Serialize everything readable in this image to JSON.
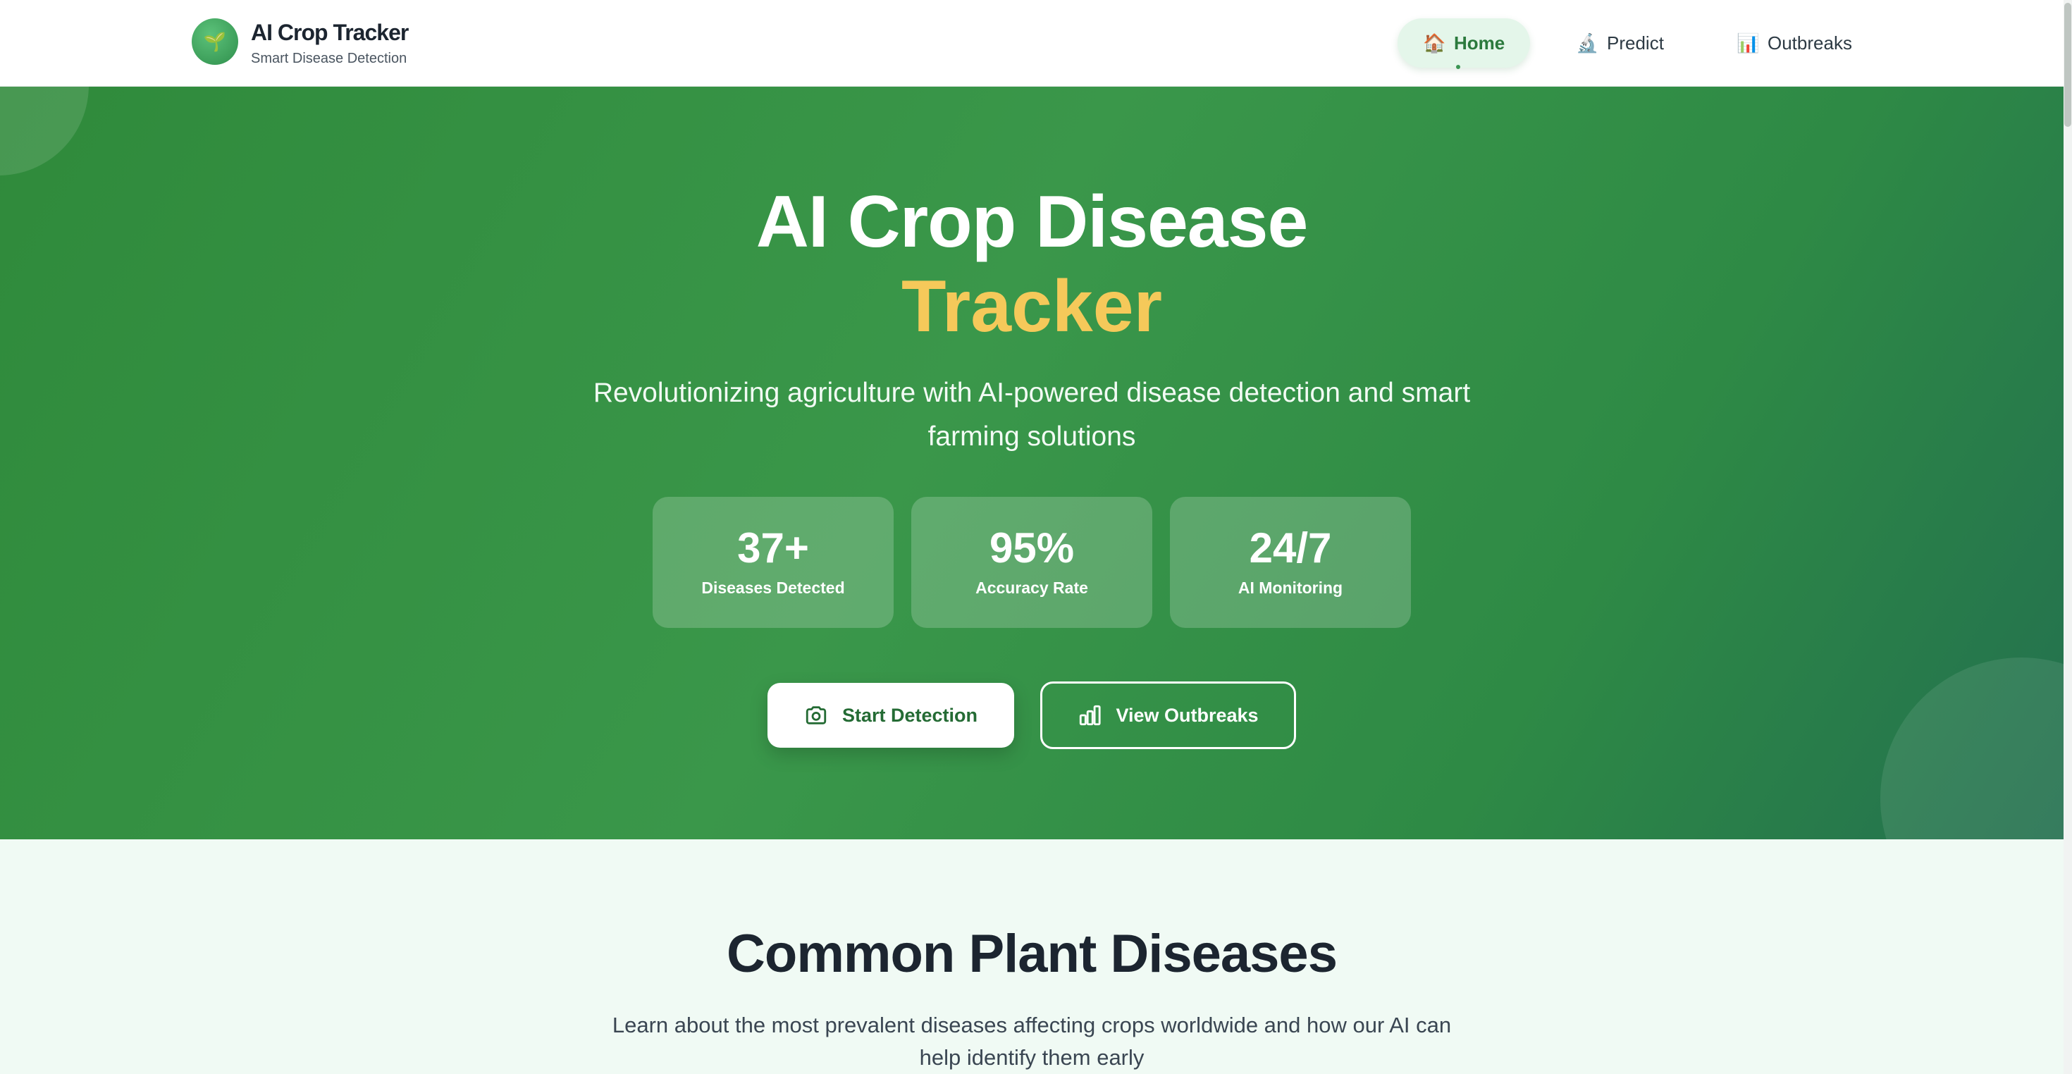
{
  "brand": {
    "title": "AI Crop Tracker",
    "subtitle": "Smart Disease Detection",
    "logo_icon": "sprout-icon"
  },
  "nav": {
    "items": [
      {
        "label": "Home",
        "icon": "🏠",
        "active": true
      },
      {
        "label": "Predict",
        "icon": "🔬",
        "active": false
      },
      {
        "label": "Outbreaks",
        "icon": "📊",
        "active": false
      }
    ]
  },
  "hero": {
    "title_line1": "AI Crop Disease",
    "title_line2": "Tracker",
    "subtitle": "Revolutionizing agriculture with AI-powered disease detection and smart farming solutions",
    "stats": [
      {
        "value": "37+",
        "label": "Diseases Detected"
      },
      {
        "value": "95%",
        "label": "Accuracy Rate"
      },
      {
        "value": "24/7",
        "label": "AI Monitoring"
      }
    ],
    "primary_button": "Start Detection",
    "secondary_button": "View Outbreaks"
  },
  "section": {
    "title": "Common Plant Diseases",
    "subtitle": "Learn about the most prevalent diseases affecting crops worldwide and how our AI can help identify them early"
  },
  "colors": {
    "hero_green": "#3a974a",
    "accent_yellow": "#f5c95a",
    "active_nav_bg": "#e4f6ea",
    "section_bg": "#f0faf4"
  }
}
